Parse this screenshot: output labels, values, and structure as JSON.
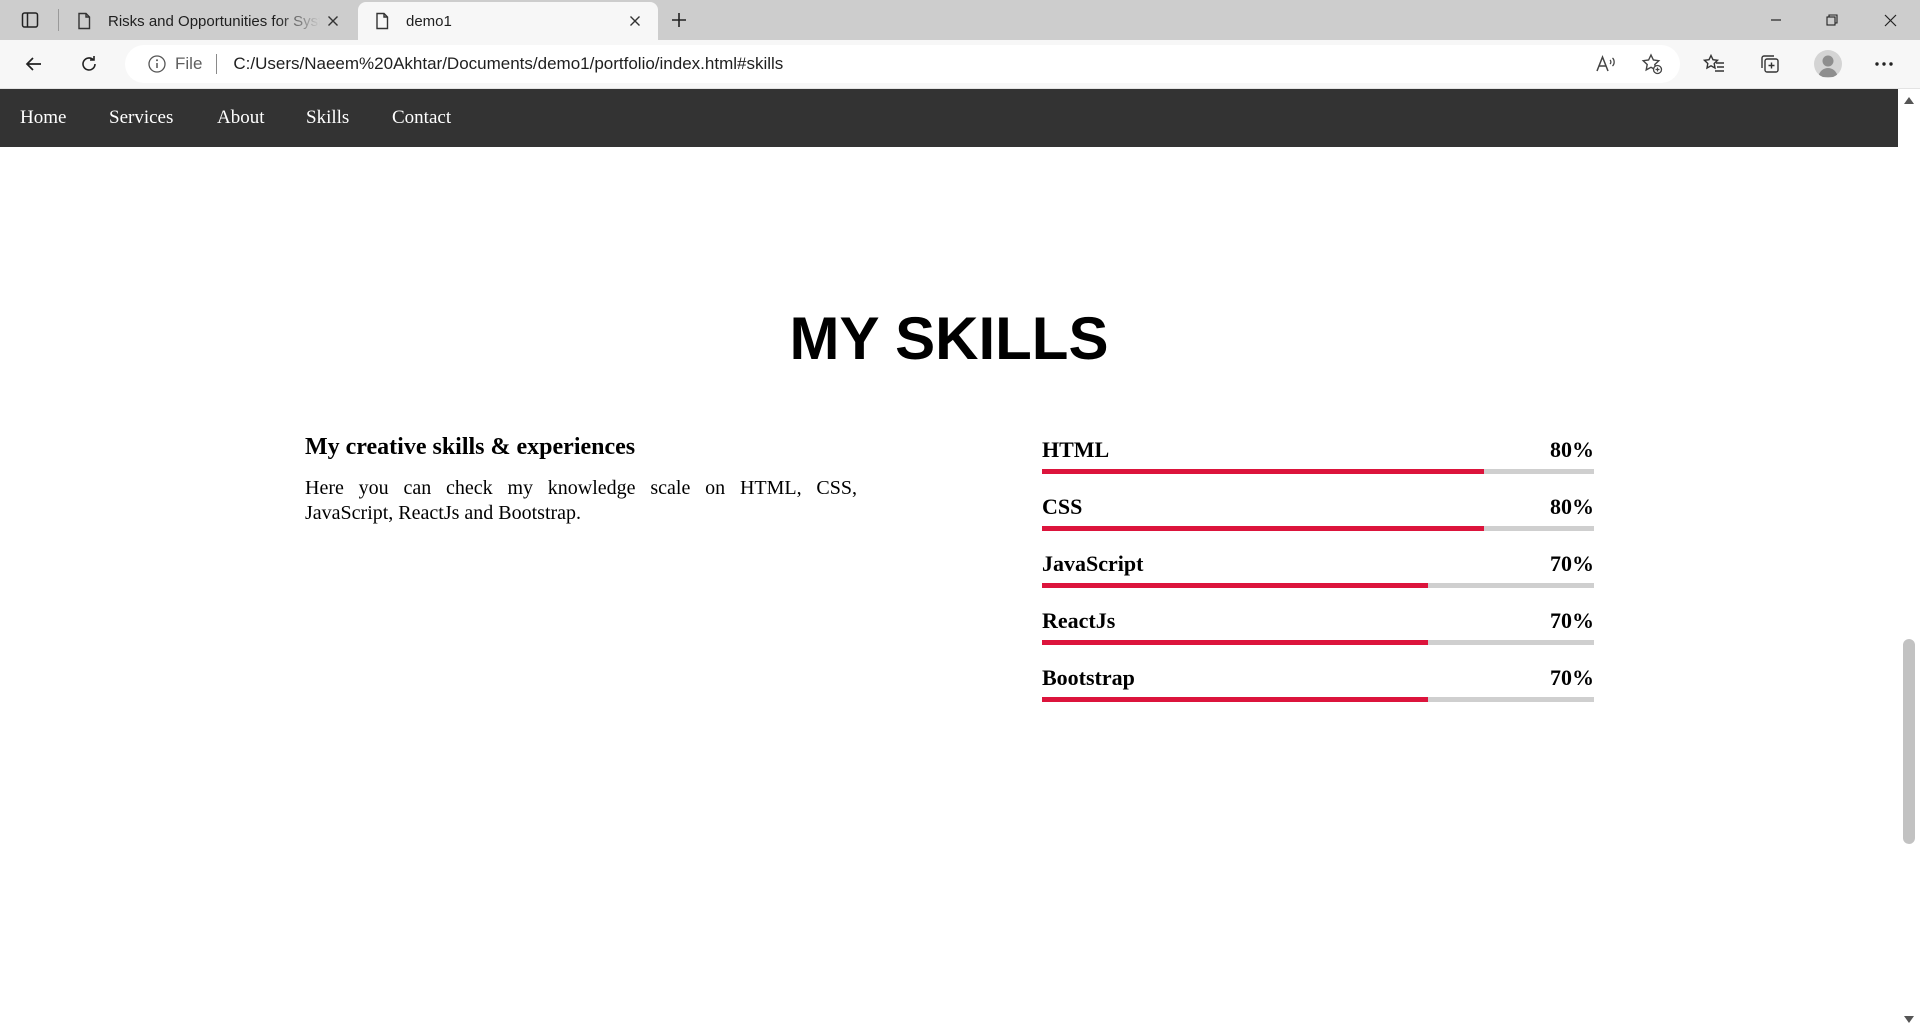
{
  "browser": {
    "tabs": [
      {
        "title": "Risks and Opportunities for Systems",
        "icon": "page-icon",
        "active": false
      },
      {
        "title": "demo1",
        "icon": "page-icon",
        "active": true
      }
    ],
    "address_bar": {
      "scheme_label": "File",
      "url": "C:/Users/Naeem%20Akhtar/Documents/demo1/portfolio/index.html#skills"
    }
  },
  "site": {
    "nav": [
      "Home",
      "Services",
      "About",
      "Skills",
      "Contact"
    ],
    "skills_section": {
      "title": "MY SKILLS",
      "subtitle": "My creative skills & experiences",
      "description": "Here you can check my knowledge scale on HTML, CSS, JavaScript, ReactJs and Bootstrap.",
      "skills": [
        {
          "name": "HTML",
          "percent": "80%",
          "level": 0.8
        },
        {
          "name": "CSS",
          "percent": "80%",
          "level": 0.8
        },
        {
          "name": "JavaScript",
          "percent": "70%",
          "level": 0.7
        },
        {
          "name": "ReactJs",
          "percent": "70%",
          "level": 0.7
        },
        {
          "name": "Bootstrap",
          "percent": "70%",
          "level": 0.7
        }
      ]
    }
  },
  "colors": {
    "nav_bg": "#333333",
    "bar_fill": "#dc143c",
    "bar_track": "#cfcfcf"
  }
}
